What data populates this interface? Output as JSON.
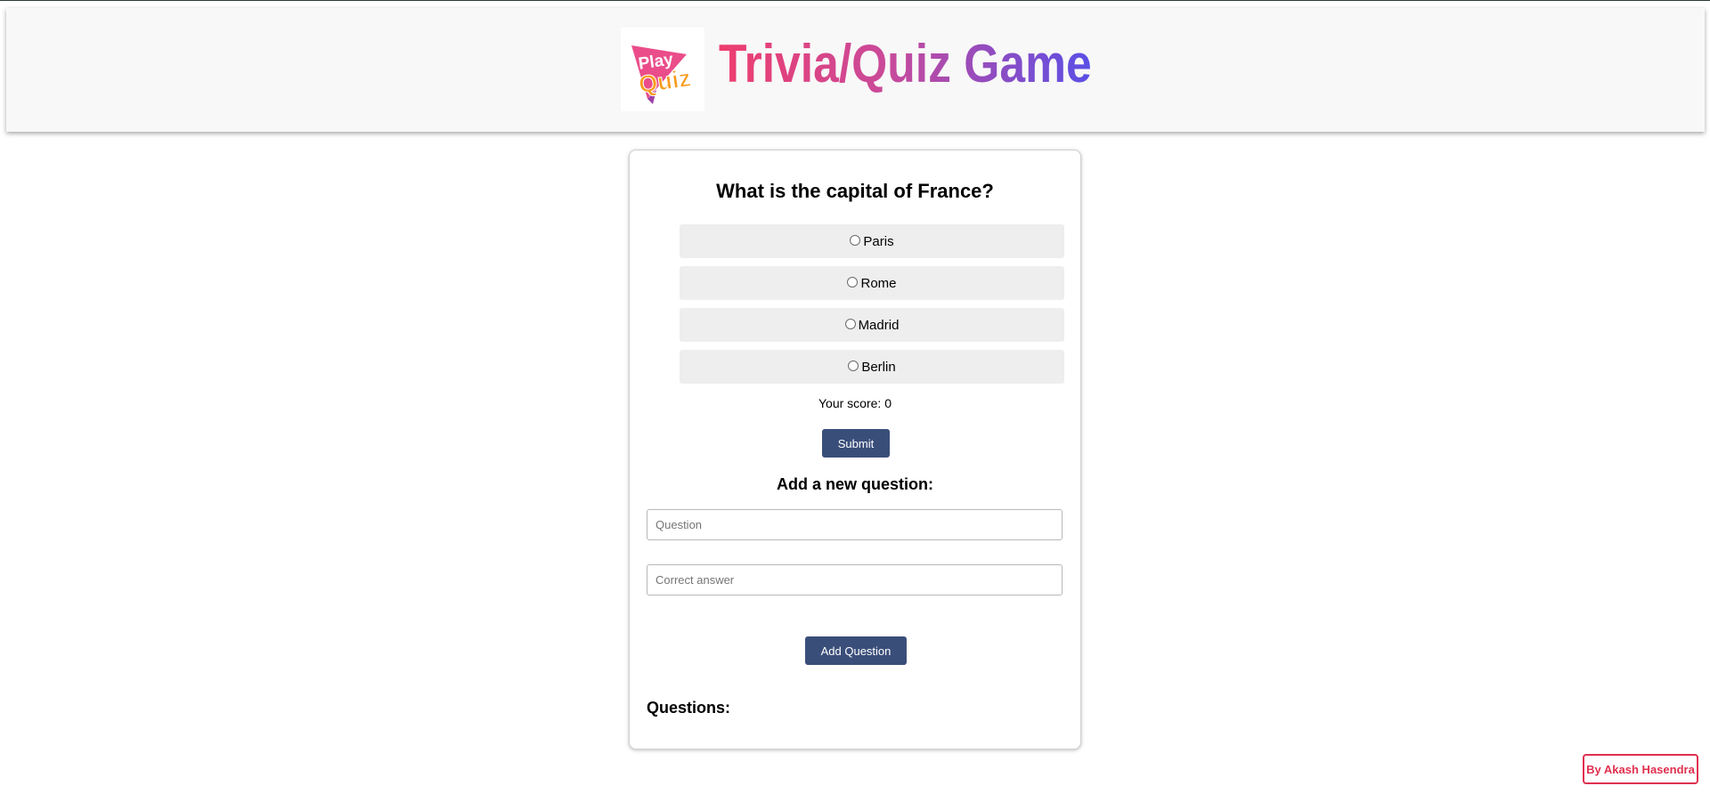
{
  "header": {
    "logo": {
      "line1": "Play",
      "line2": "Quiz"
    },
    "title": "Trivia/Quiz Game"
  },
  "quiz": {
    "question": "What is the capital of France?",
    "options": [
      "Paris",
      "Rome",
      "Madrid",
      "Berlin"
    ],
    "score_text": "Your score: 0",
    "submit_label": "Submit"
  },
  "add_form": {
    "title": "Add a new question:",
    "question_placeholder": "Question",
    "answer_placeholder": "Correct answer",
    "button_label": "Add Question"
  },
  "questions_list": {
    "title": "Questions:"
  },
  "footer": {
    "author": "By Akash Hasendra"
  },
  "colors": {
    "button": "#3a4e7a",
    "title_gradient_start": "#ee3d6e",
    "title_gradient_end": "#5a4fe6",
    "author_accent": "#e0304f",
    "option_bg": "#eeeeee"
  }
}
